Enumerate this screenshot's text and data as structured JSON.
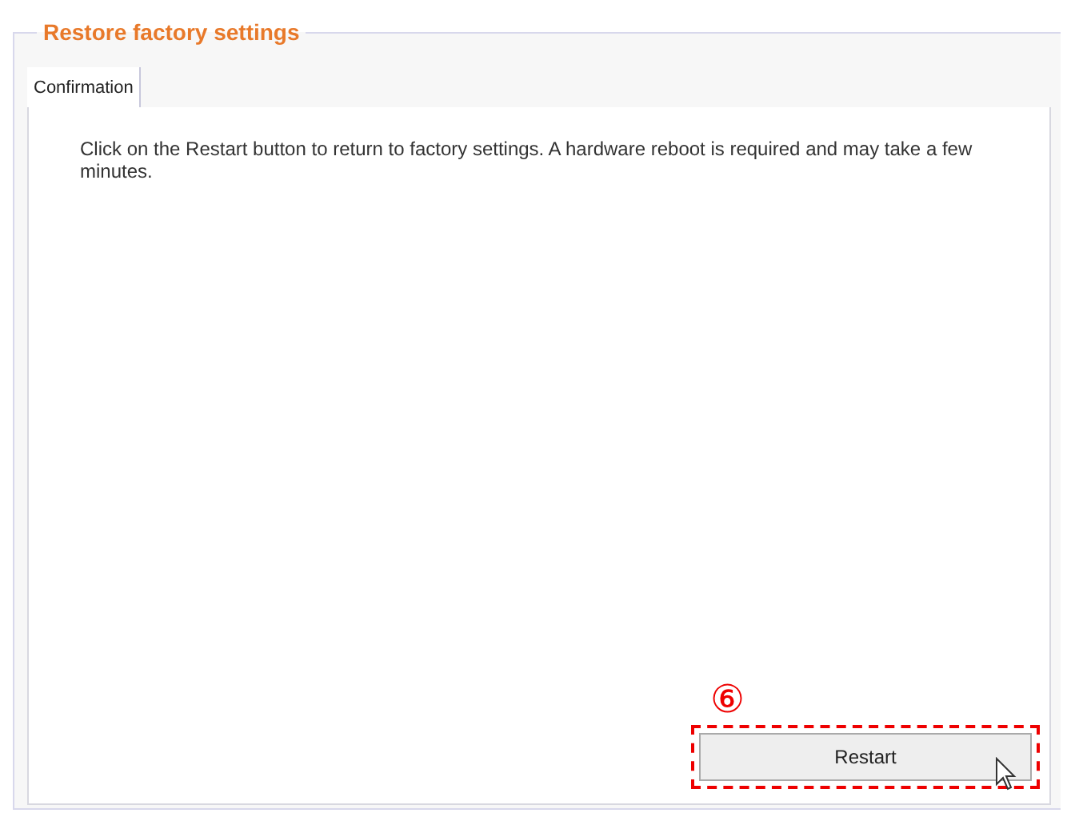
{
  "section": {
    "title": "Restore factory settings"
  },
  "tabs": [
    {
      "label": "Confirmation",
      "selected": true
    }
  ],
  "message": "Click on the Restart button to return to factory settings. A hardware reboot is required and may take a few minutes.",
  "button": {
    "label": "Restart"
  },
  "annotation": {
    "label": "⑥"
  }
}
